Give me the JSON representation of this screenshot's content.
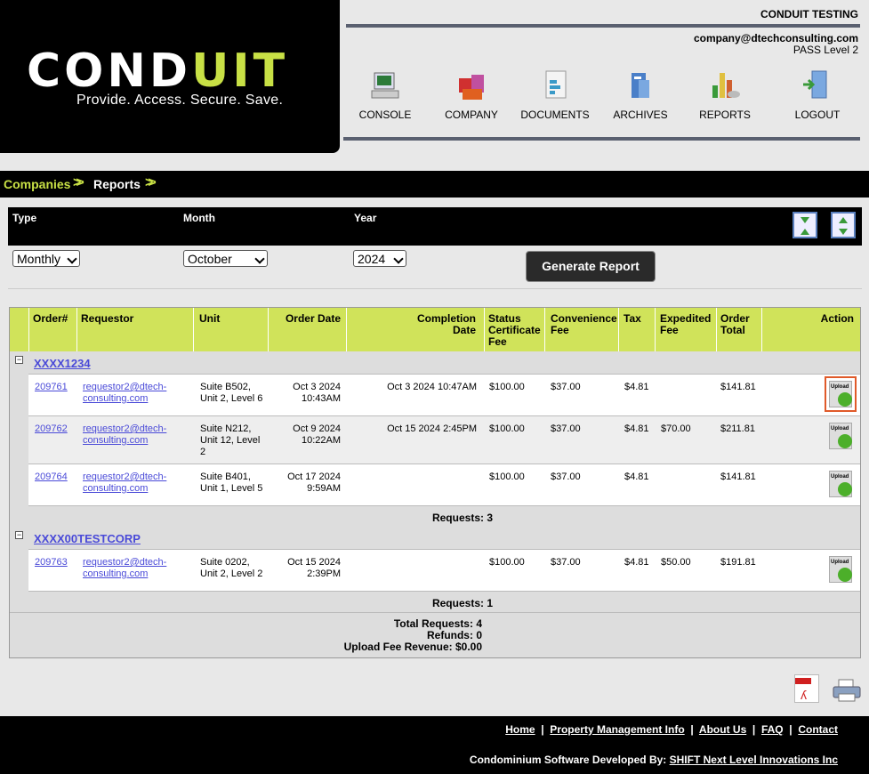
{
  "brand": {
    "word_a": "COND",
    "word_b": "UIT",
    "tagline": "Provide. Access. Secure. Save."
  },
  "header": {
    "org_name": "CONDUIT TESTING",
    "user_email": "company@dtechconsulting.com",
    "user_level": "PASS Level 2"
  },
  "nav": [
    {
      "label": "CONSOLE",
      "icon": "console-icon"
    },
    {
      "label": "COMPANY",
      "icon": "company-icon"
    },
    {
      "label": "DOCUMENTS",
      "icon": "documents-icon"
    },
    {
      "label": "ARCHIVES",
      "icon": "archives-icon"
    },
    {
      "label": "REPORTS",
      "icon": "reports-icon"
    },
    {
      "label": "LOGOUT",
      "icon": "logout-icon"
    }
  ],
  "breadcrumb": [
    "Companies",
    "Reports"
  ],
  "filters": {
    "type_label": "Type",
    "month_label": "Month",
    "year_label": "Year",
    "type_value": "Monthly",
    "month_value": "October",
    "year_value": "2024",
    "generate_label": "Generate Report"
  },
  "columns": {
    "order": "Order#",
    "requestor": "Requestor",
    "unit": "Unit",
    "order_date": "Order Date",
    "completion_1": "Completion",
    "completion_2": "Date",
    "status_1": "Status",
    "status_2": "Certificate",
    "status_3": "Fee",
    "conv_1": "Convenience",
    "conv_2": "Fee",
    "tax": "Tax",
    "exp_1": "Expedited",
    "exp_2": "Fee",
    "total_1": "Order",
    "total_2": "Total",
    "action": "Action"
  },
  "groups": [
    {
      "name": "XXXX1234",
      "toggle": "−",
      "requests_label": "Requests: 3",
      "rows": [
        {
          "order": "209761",
          "req1": "requestor2@dtech-",
          "req2": "consulting.com",
          "unit1": "Suite B502,",
          "unit2": "Unit 2, Level 6",
          "unit3": "",
          "date1": "Oct 3 2024",
          "date2": "10:43AM",
          "completion": "Oct 3 2024 10:47AM",
          "status_fee": "$100.00",
          "conv_fee": "$37.00",
          "tax": "$4.81",
          "exp_fee": "",
          "total": "$141.81",
          "upload": "Upload"
        },
        {
          "order": "209762",
          "req1": "requestor2@dtech-",
          "req2": "consulting.com",
          "unit1": "Suite N212,",
          "unit2": "Unit 12, Level",
          "unit3": "2",
          "date1": "Oct 9 2024",
          "date2": "10:22AM",
          "completion": "Oct 15 2024 2:45PM",
          "status_fee": "$100.00",
          "conv_fee": "$37.00",
          "tax": "$4.81",
          "exp_fee": "$70.00",
          "total": "$211.81",
          "upload": "Upload"
        },
        {
          "order": "209764",
          "req1": "requestor2@dtech-",
          "req2": "consulting.com",
          "unit1": "Suite B401,",
          "unit2": "Unit 1, Level 5",
          "unit3": "",
          "date1": "Oct 17 2024",
          "date2": "9:59AM",
          "completion": "",
          "status_fee": "$100.00",
          "conv_fee": "$37.00",
          "tax": "$4.81",
          "exp_fee": "",
          "total": "$141.81",
          "upload": "Upload"
        }
      ]
    },
    {
      "name": "XXXX00TESTCORP",
      "toggle": "−",
      "requests_label": "Requests: 1",
      "rows": [
        {
          "order": "209763",
          "req1": "requestor2@dtech-",
          "req2": "consulting.com",
          "unit1": "Suite 0202,",
          "unit2": "Unit 2, Level 2",
          "unit3": "",
          "date1": "Oct 15 2024",
          "date2": "2:39PM",
          "completion": "",
          "status_fee": "$100.00",
          "conv_fee": "$37.00",
          "tax": "$4.81",
          "exp_fee": "$50.00",
          "total": "$191.81",
          "upload": "Upload"
        }
      ]
    }
  ],
  "totals": {
    "total_requests": "Total Requests: 4",
    "refunds": "Refunds: 0",
    "upload_revenue": "Upload Fee Revenue: $0.00"
  },
  "footer": {
    "links": [
      "Home",
      "Property Management Info",
      "About Us",
      "FAQ",
      "Contact"
    ],
    "separator": "|",
    "credit_prefix": "Condominium Software Developed By:",
    "credit_link": "SHIFT Next Level Innovations Inc"
  },
  "colors": {
    "accent": "#c8e045",
    "header_bar": "#5a6070",
    "link": "#4a4ad8",
    "highlight": "#e05a2a"
  }
}
